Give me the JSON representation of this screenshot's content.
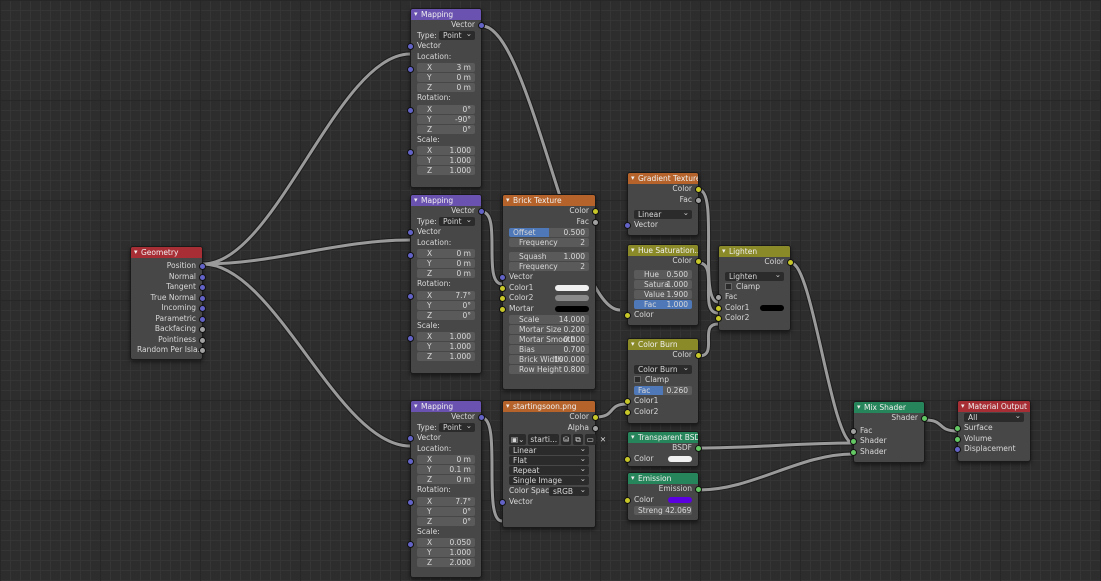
{
  "colors": {
    "vector_socket": "#6363c7",
    "color_socket": "#c7c729",
    "float_socket": "#a1a1a1",
    "shader_socket": "#63c763",
    "emission_color": "#5b00e0"
  },
  "geometry": {
    "title": "Geometry",
    "outputs": [
      "Position",
      "Normal",
      "Tangent",
      "True Normal",
      "Incoming",
      "Parametric",
      "Backfacing",
      "Pointiness",
      "Random Per Isla..."
    ]
  },
  "mapping1": {
    "title": "Mapping",
    "out": "Vector",
    "type_label": "Type:",
    "type_value": "Point",
    "in": "Vector",
    "loc_label": "Location:",
    "loc": [
      "3 m",
      "0 m",
      "0 m"
    ],
    "rot_label": "Rotation:",
    "rot": [
      "0°",
      "-90°",
      "0°"
    ],
    "scale_label": "Scale:",
    "scale": [
      "1.000",
      "1.000",
      "1.000"
    ]
  },
  "mapping2": {
    "title": "Mapping",
    "out": "Vector",
    "type_label": "Type:",
    "type_value": "Point",
    "in": "Vector",
    "loc_label": "Location:",
    "loc": [
      "0 m",
      "0 m",
      "0 m"
    ],
    "rot_label": "Rotation:",
    "rot": [
      "7.7°",
      "0°",
      "0°"
    ],
    "scale_label": "Scale:",
    "scale": [
      "1.000",
      "1.000",
      "1.000"
    ]
  },
  "mapping3": {
    "title": "Mapping",
    "out": "Vector",
    "type_label": "Type:",
    "type_value": "Point",
    "in": "Vector",
    "loc_label": "Location:",
    "loc": [
      "0 m",
      "0.1 m",
      "0 m"
    ],
    "rot_label": "Rotation:",
    "rot": [
      "7.7°",
      "0°",
      "0°"
    ],
    "scale_label": "Scale:",
    "scale": [
      "0.050",
      "1.000",
      "2.000"
    ]
  },
  "axes": [
    "X",
    "Y",
    "Z"
  ],
  "brick": {
    "title": "Brick Texture",
    "out_color": "Color",
    "out_fac": "Fac",
    "offset_label": "Offset",
    "offset": "0.500",
    "freq1_label": "Frequency",
    "freq1": "2",
    "squash_label": "Squash",
    "squash": "1.000",
    "freq2_label": "Frequency",
    "freq2": "2",
    "vector": "Vector",
    "color1": "Color1",
    "color2": "Color2",
    "mortar": "Mortar",
    "params": [
      [
        "Scale",
        "14.000"
      ],
      [
        "Mortar Size",
        "0.200"
      ],
      [
        "Mortar Smooth",
        "0.000"
      ],
      [
        "Bias",
        "0.700"
      ],
      [
        "Brick Width",
        "100.000"
      ],
      [
        "Row Height",
        "0.800"
      ]
    ]
  },
  "image": {
    "title": "startingsoon.png",
    "out_color": "Color",
    "out_alpha": "Alpha",
    "file": "starti...",
    "interp": "Linear",
    "proj": "Flat",
    "ext": "Repeat",
    "source": "Single Image",
    "cs_label": "Color Space",
    "cs_value": "sRGB",
    "vector": "Vector"
  },
  "gradient": {
    "title": "Gradient Texture",
    "out_color": "Color",
    "out_fac": "Fac",
    "type": "Linear",
    "vector": "Vector"
  },
  "hue": {
    "title": "Hue Saturation...",
    "out_color": "Color",
    "fields": [
      [
        "Hue",
        "0.500"
      ],
      [
        "Satura",
        "1.000"
      ],
      [
        "Value",
        "1.900"
      ],
      [
        "Fac",
        "1.000"
      ]
    ],
    "in_color": "Color"
  },
  "burn": {
    "title": "Color Burn",
    "out_color": "Color",
    "mode": "Color Burn",
    "clamp": "Clamp",
    "fac_label": "Fac",
    "fac": "0.260",
    "color1": "Color1",
    "color2": "Color2"
  },
  "lighten": {
    "title": "Lighten",
    "out_color": "Color",
    "mode": "Lighten",
    "clamp": "Clamp",
    "fac": "Fac",
    "color1": "Color1",
    "color2": "Color2"
  },
  "transparent": {
    "title": "Transparent BSDF",
    "out": "BSDF",
    "color": "Color"
  },
  "emission": {
    "title": "Emission",
    "out": "Emission",
    "color": "Color",
    "strength_label": "Streng",
    "strength": "42.069"
  },
  "mix": {
    "title": "Mix Shader",
    "out": "Shader",
    "fac": "Fac",
    "shader1": "Shader",
    "shader2": "Shader"
  },
  "output": {
    "title": "Material Output",
    "target": "All",
    "surface": "Surface",
    "volume": "Volume",
    "displacement": "Displacement"
  }
}
